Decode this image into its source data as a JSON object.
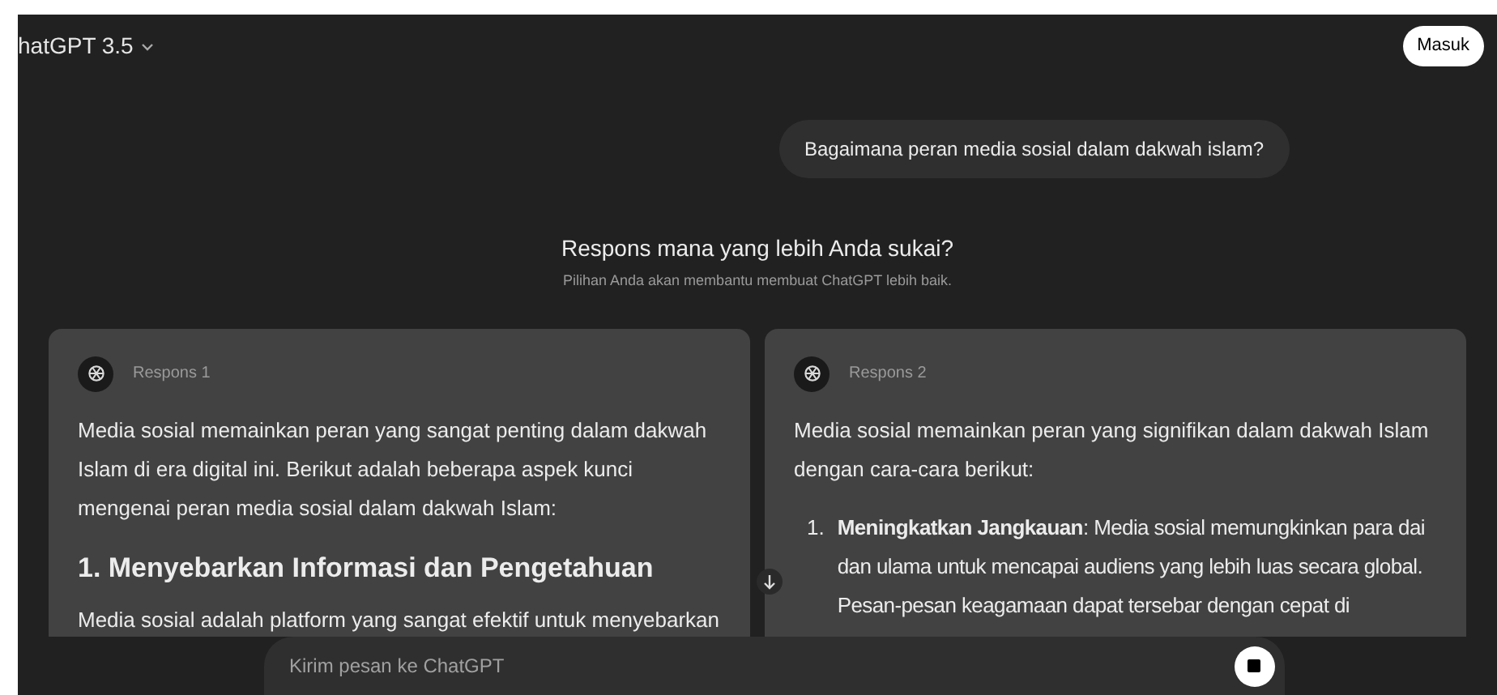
{
  "header": {
    "model": "hatGPT 3.5",
    "login": "Masuk"
  },
  "user_message": "Bagaimana peran media sosial dalam dakwah islam?",
  "comparison": {
    "title": "Respons mana yang lebih Anda sukai?",
    "subtitle": "Pilihan Anda akan membantu membuat ChatGPT lebih baik."
  },
  "responses": [
    {
      "label": "Respons 1",
      "blocks": [
        {
          "kind": "paragraph",
          "text": "Media sosial memainkan peran yang sangat penting dalam dakwah Islam di era digital ini. Berikut adalah beberapa aspek kunci mengenai peran media sosial dalam dakwah Islam:"
        },
        {
          "kind": "heading",
          "text": "1. Menyebarkan Informasi dan Pengetahuan"
        },
        {
          "kind": "paragraph",
          "text": "Media sosial adalah platform yang sangat efektif untuk menyebarkan"
        }
      ]
    },
    {
      "label": "Respons 2",
      "blocks": [
        {
          "kind": "paragraph",
          "text": "Media sosial memainkan peran yang signifikan dalam dakwah Islam dengan cara-cara berikut:"
        },
        {
          "kind": "list_item",
          "marker": "1.",
          "text": "**Meningkatkan Jangkauan**: Media sosial memungkinkan para dai dan ulama untuk mencapai audiens yang lebih luas secara global. Pesan-pesan keagamaan dapat tersebar dengan cepat di"
        }
      ]
    }
  ],
  "composer": {
    "placeholder": "Kirim pesan ke ChatGPT"
  }
}
